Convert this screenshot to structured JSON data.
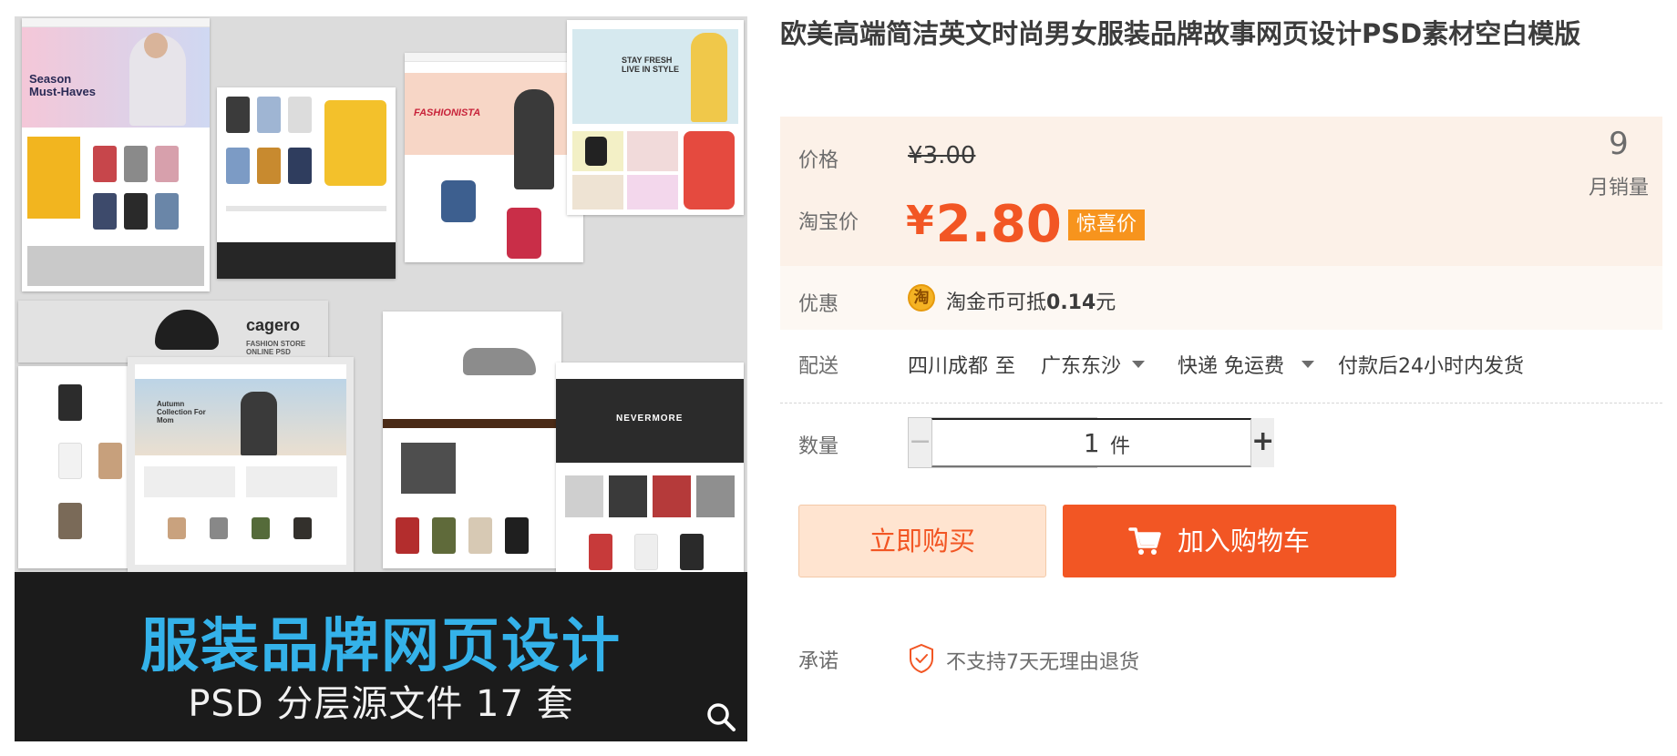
{
  "product": {
    "title": "欧美高端简洁英文时尚男女服装品牌故事网页设计PSD素材空白模版"
  },
  "gallery": {
    "collage_texts": {
      "season": "Season Must-Haves",
      "fashionista": "FASHIONISTA",
      "stay_fresh": "STAY FRESH LIVE IN STYLE",
      "brand": "cagero",
      "brand_sub": "FASHION STORE ONLINE PSD",
      "autumn": "Autumn Collection For Mom",
      "nevermore": "NEVERMORE"
    },
    "banner_title": "服装品牌网页设计",
    "banner_subtitle": "PSD 分层源文件 17 套",
    "zoom_icon": "magnifier-icon"
  },
  "price": {
    "label": "价格",
    "original": "¥3.00",
    "taobao_label": "淘宝价",
    "taobao_symbol": "¥",
    "taobao_value": "2.80",
    "badge": "惊喜价"
  },
  "sales": {
    "count": "9",
    "label": "月销量"
  },
  "promotion": {
    "label": "优惠",
    "coin_icon_glyph": "淘",
    "text_prefix": "淘金币可抵",
    "amount": "0.14",
    "text_suffix": "元"
  },
  "shipping": {
    "label": "配送",
    "from": "四川成都",
    "to_word": "至",
    "destination": "广东东沙",
    "method": "快递 免运费",
    "dispatch": "付款后24小时内发货"
  },
  "quantity": {
    "label": "数量",
    "minus": "−",
    "value": "1",
    "plus": "+",
    "unit": "件"
  },
  "actions": {
    "buy_now": "立即购买",
    "add_to_cart": "加入购物车"
  },
  "promise": {
    "label": "承诺",
    "text": "不支持7天无理由退货"
  },
  "colors": {
    "accent": "#f25624",
    "badge": "#f7941d",
    "price_bg": "#fcf1e8",
    "promo_bg": "#fdf8f3",
    "buy_now_bg": "#ffe4d0",
    "banner_title": "#34b2ea"
  }
}
